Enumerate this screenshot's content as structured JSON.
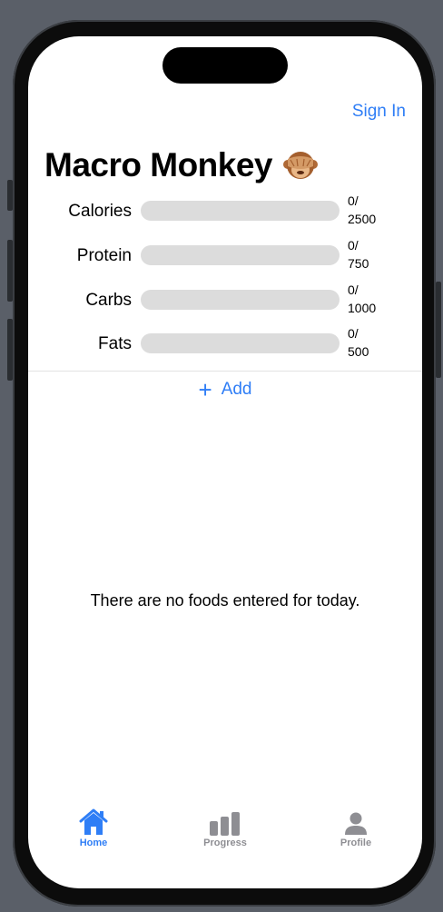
{
  "header": {
    "sign_in_label": "Sign In",
    "app_title": "Macro Monkey",
    "title_emoji": "🙈"
  },
  "macros": [
    {
      "label": "Calories",
      "current": "0/",
      "goal": "2500",
      "progress": 0
    },
    {
      "label": "Protein",
      "current": "0/",
      "goal": "750",
      "progress": 0
    },
    {
      "label": "Carbs",
      "current": "0/",
      "goal": "1000",
      "progress": 0
    },
    {
      "label": "Fats",
      "current": "0/",
      "goal": "500",
      "progress": 0
    }
  ],
  "add_label": "Add",
  "empty_message": "There are no foods entered for today.",
  "tabs": [
    {
      "label": "Home",
      "icon": "house-icon",
      "active": true
    },
    {
      "label": "Progress",
      "icon": "bar-chart-icon",
      "active": false
    },
    {
      "label": "Profile",
      "icon": "person-icon",
      "active": false
    }
  ],
  "colors": {
    "accent": "#2f7ef6",
    "inactive_tab": "#8e8e93",
    "track": "#dcdcdc"
  }
}
